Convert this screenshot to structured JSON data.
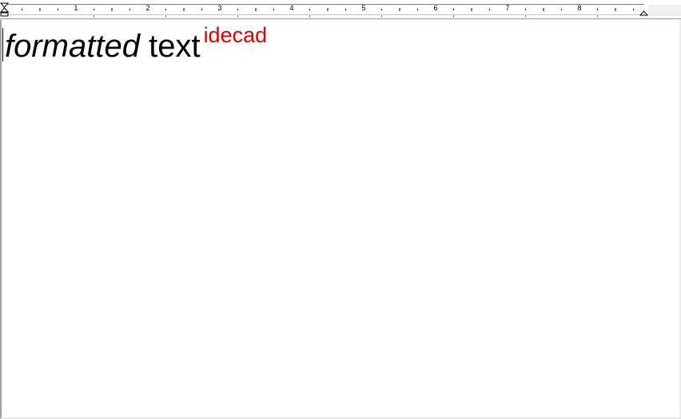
{
  "ruler": {
    "numbers": [
      "1",
      "2",
      "3",
      "4",
      "5",
      "6",
      "7",
      "8"
    ]
  },
  "document": {
    "runs": [
      {
        "text": "formatted",
        "style": "italic"
      },
      {
        "text": " text",
        "style": "normal"
      },
      {
        "text": "idecad",
        "style": "superscript",
        "color": "#e00000"
      }
    ]
  }
}
